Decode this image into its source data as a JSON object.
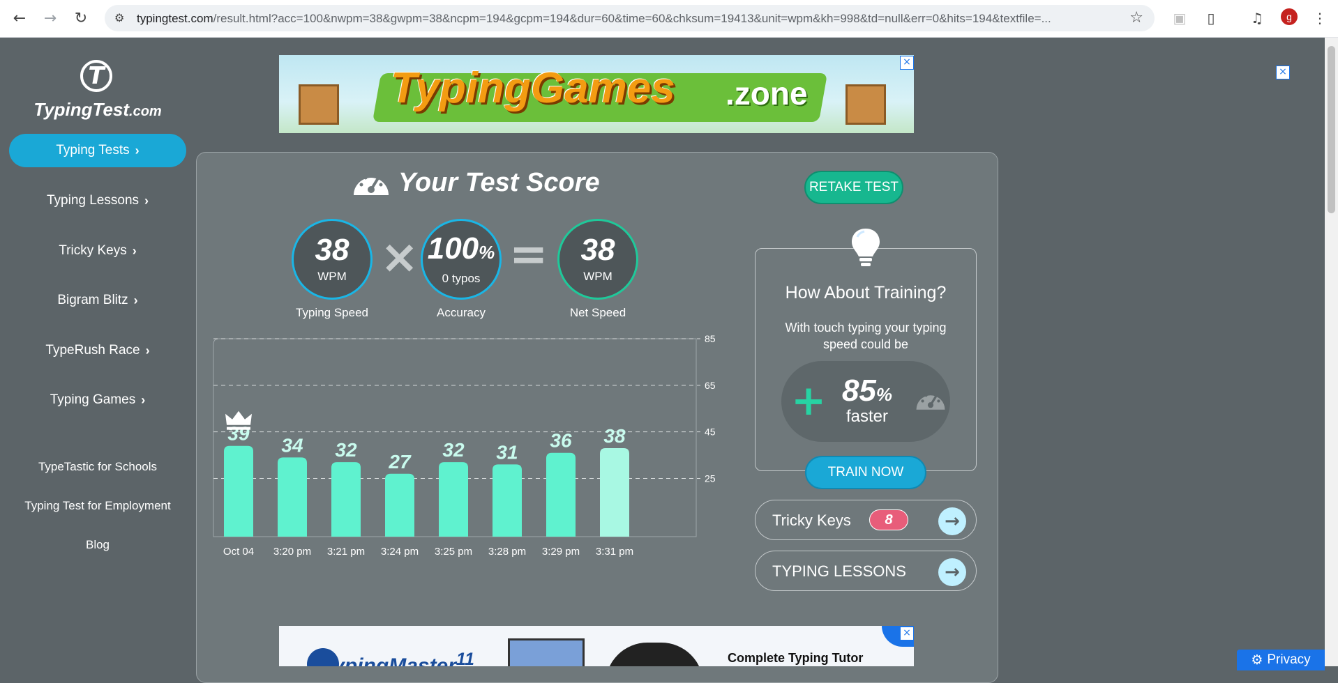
{
  "browser": {
    "url_domain": "typingtest.com",
    "url_rest": "/result.html?acc=100&nwpm=38&gwpm=38&ncpm=194&gcpm=194&dur=60&time=60&chksum=19413&unit=wpm&kh=998&td=null&err=0&hits=194&textfile=...",
    "profile_initial": "g"
  },
  "logo": {
    "name": "TypingTest",
    "tld": ".com",
    "mark": "T"
  },
  "sidebar": {
    "items": [
      {
        "label": "Typing Tests",
        "active": true
      },
      {
        "label": "Typing Lessons",
        "active": false
      },
      {
        "label": "Tricky Keys",
        "active": false
      },
      {
        "label": "Bigram Blitz",
        "active": false
      },
      {
        "label": "TypeRush Race",
        "active": false
      },
      {
        "label": "Typing Games",
        "active": false
      }
    ],
    "links": [
      "TypeTastic for Schools",
      "Typing Test for Employment",
      "Blog"
    ]
  },
  "ads": {
    "top": {
      "brand": "TypingGames",
      "suffix": ".zone"
    },
    "bottom": {
      "brand": "TypingMaster",
      "version": "11",
      "headline": "Complete Typing Tutor"
    }
  },
  "score": {
    "title": "Your Test Score",
    "retake_label": "RETAKE TEST",
    "typing_speed": {
      "value": "38",
      "unit": "WPM",
      "label": "Typing Speed"
    },
    "accuracy": {
      "value": "100",
      "unit": "%",
      "sub": "0 typos",
      "label": "Accuracy"
    },
    "net_speed": {
      "value": "38",
      "unit": "WPM",
      "label": "Net Speed"
    }
  },
  "chart_data": {
    "type": "bar",
    "categories": [
      "Oct 04",
      "3:20 pm",
      "3:21 pm",
      "3:24 pm",
      "3:25 pm",
      "3:28 pm",
      "3:29 pm",
      "3:31 pm"
    ],
    "values": [
      39,
      34,
      32,
      27,
      32,
      31,
      36,
      38
    ],
    "yticks": [
      25,
      45,
      65,
      85
    ],
    "ylim": [
      0,
      85
    ],
    "best_index": 0,
    "current_index": 7,
    "grid": true,
    "colors": {
      "bar": "#5ff2cf",
      "current_bar": "#a8f8e3",
      "label": "#c9fbee"
    }
  },
  "training": {
    "title": "How About Training?",
    "text": "With touch typing your typing speed could be",
    "improvement": "85",
    "unit": "%",
    "faster": "faster",
    "button": "TRAIN NOW"
  },
  "tricky_keys": {
    "label": "Tricky Keys",
    "count": "8"
  },
  "lessons": {
    "label": "TYPING LESSONS"
  },
  "privacy": {
    "label": "Privacy"
  }
}
